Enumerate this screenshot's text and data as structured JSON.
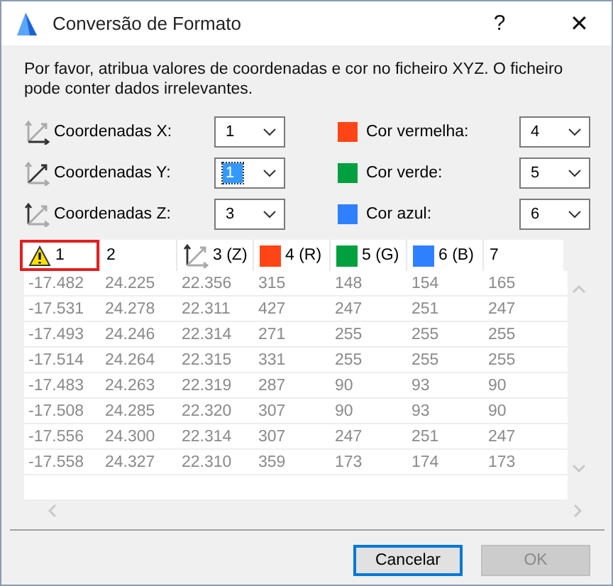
{
  "window": {
    "title": "Conversão de Formato",
    "help": "?",
    "close": "✕"
  },
  "intro": "Por favor, atribua valores de coordenadas e cor no ficheiro XYZ. O ficheiro pode conter dados irrelevantes.",
  "coordinates": [
    {
      "label": "Coordenadas X:",
      "kind": "x",
      "value": "1",
      "focused": false
    },
    {
      "label": "Coordenadas Y:",
      "kind": "y",
      "value": "1",
      "focused": true
    },
    {
      "label": "Coordenadas Z:",
      "kind": "z",
      "value": "3",
      "focused": false
    }
  ],
  "colors": [
    {
      "label": "Cor vermelha:",
      "color": "#ff4517",
      "value": "4"
    },
    {
      "label": "Cor verde:",
      "color": "#00a040",
      "value": "5"
    },
    {
      "label": "Cor azul:",
      "color": "#2f80ff",
      "value": "6"
    }
  ],
  "table": {
    "columns": [
      {
        "label": "1",
        "kind": "warning",
        "selected": true
      },
      {
        "label": "2",
        "kind": "plain",
        "selected": false
      },
      {
        "label": "3 (Z)",
        "kind": "z-axis",
        "selected": false
      },
      {
        "label": "4 (R)",
        "kind": "color",
        "color": "#ff4517",
        "selected": false
      },
      {
        "label": "5 (G)",
        "kind": "color",
        "color": "#00a040",
        "selected": false
      },
      {
        "label": "6 (B)",
        "kind": "color",
        "color": "#2f80ff",
        "selected": false
      },
      {
        "label": "7",
        "kind": "plain",
        "selected": false
      }
    ],
    "rows": [
      [
        "-17.482",
        "24.225",
        "22.356",
        "315",
        "148",
        "154",
        "165"
      ],
      [
        "-17.531",
        "24.278",
        "22.311",
        "427",
        "247",
        "251",
        "247"
      ],
      [
        "-17.493",
        "24.246",
        "22.314",
        "271",
        "255",
        "255",
        "255"
      ],
      [
        "-17.514",
        "24.264",
        "22.315",
        "331",
        "255",
        "255",
        "255"
      ],
      [
        "-17.483",
        "24.263",
        "22.319",
        "287",
        "90",
        "93",
        "90"
      ],
      [
        "-17.508",
        "24.285",
        "22.320",
        "307",
        "90",
        "93",
        "90"
      ],
      [
        "-17.556",
        "24.300",
        "22.314",
        "307",
        "247",
        "251",
        "247"
      ],
      [
        "-17.558",
        "24.327",
        "22.310",
        "359",
        "173",
        "174",
        "173"
      ]
    ]
  },
  "buttons": [
    {
      "label": "Cancelar",
      "kind": "default"
    },
    {
      "label": "OK",
      "kind": "disabled"
    }
  ]
}
